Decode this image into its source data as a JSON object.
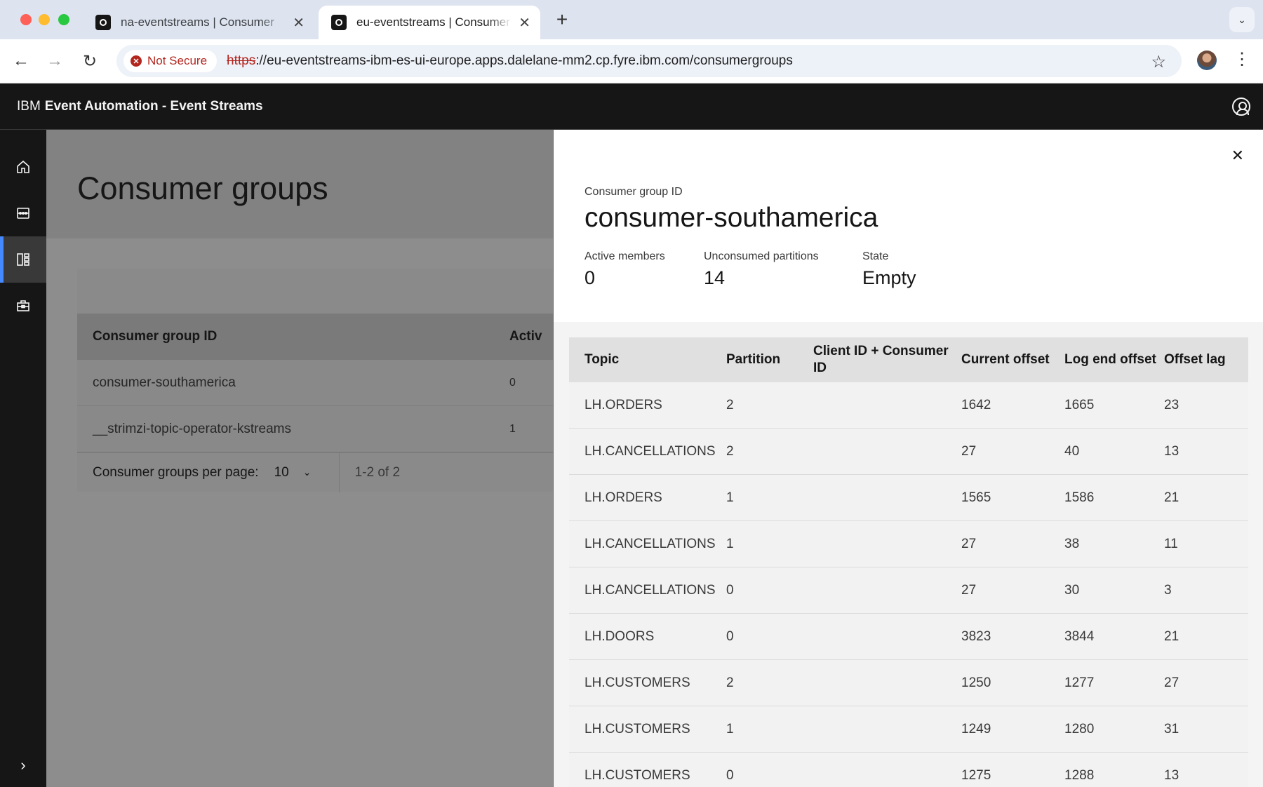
{
  "browser": {
    "tabs": [
      {
        "title": "na-eventstreams | Consumer"
      },
      {
        "title": "eu-eventstreams | Consumer"
      }
    ],
    "new_tab": "+",
    "security_label": "Not Secure",
    "url_scheme": "https",
    "url_rest": "://eu-eventstreams-ibm-es-ui-europe.apps.dalelane-mm2.cp.fyre.ibm.com/consumergroups"
  },
  "header": {
    "prefix": "IBM",
    "product": "Event Automation - Event Streams"
  },
  "sidenav": {
    "items": [
      "home-icon",
      "topics-icon",
      "consumer-groups-icon",
      "toolbox-icon"
    ],
    "active_index": 2
  },
  "page": {
    "title": "Consumer groups",
    "table": {
      "headers": [
        "Consumer group ID",
        "Activ"
      ],
      "rows": [
        [
          "consumer-southamerica",
          "0"
        ],
        [
          "__strimzi-topic-operator-kstreams",
          "1"
        ]
      ]
    },
    "pagination": {
      "label": "Consumer groups per page:",
      "page_size": "10",
      "range": "1-2 of 2"
    }
  },
  "panel": {
    "label": "Consumer group ID",
    "title": "consumer-southamerica",
    "stats": [
      {
        "label": "Active members",
        "value": "0"
      },
      {
        "label": "Unconsumed partitions",
        "value": "14"
      },
      {
        "label": "State",
        "value": "Empty"
      }
    ],
    "table": {
      "headers": [
        "Topic",
        "Partition",
        "Client ID + Consumer ID",
        "Current offset",
        "Log end offset",
        "Offset lag"
      ],
      "rows": [
        [
          "LH.ORDERS",
          "2",
          "",
          "1642",
          "1665",
          "23"
        ],
        [
          "LH.CANCELLATIONS",
          "2",
          "",
          "27",
          "40",
          "13"
        ],
        [
          "LH.ORDERS",
          "1",
          "",
          "1565",
          "1586",
          "21"
        ],
        [
          "LH.CANCELLATIONS",
          "1",
          "",
          "27",
          "38",
          "11"
        ],
        [
          "LH.CANCELLATIONS",
          "0",
          "",
          "27",
          "30",
          "3"
        ],
        [
          "LH.DOORS",
          "0",
          "",
          "3823",
          "3844",
          "21"
        ],
        [
          "LH.CUSTOMERS",
          "2",
          "",
          "1250",
          "1277",
          "27"
        ],
        [
          "LH.CUSTOMERS",
          "1",
          "",
          "1249",
          "1280",
          "31"
        ],
        [
          "LH.CUSTOMERS",
          "0",
          "",
          "1275",
          "1288",
          "13"
        ]
      ]
    }
  },
  "colors": {
    "accent": "#4589ff",
    "header_bg": "#161616",
    "danger": "#b3261e"
  }
}
